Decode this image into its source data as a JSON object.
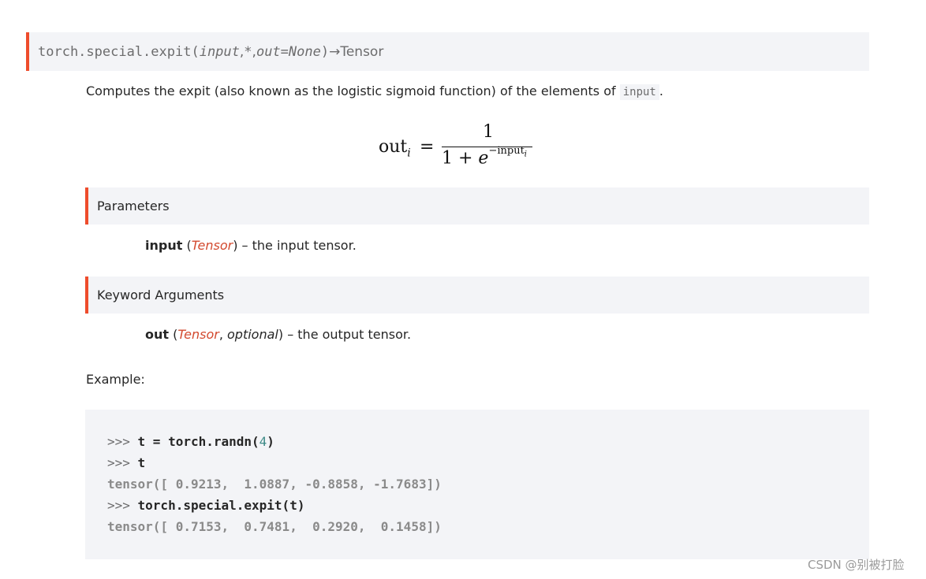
{
  "signature": {
    "func": "torch.special.expit(",
    "arg_input": "input",
    "sep1": ", ",
    "star": "*",
    "sep2": ", ",
    "arg_out": "out=None",
    "close": ")",
    "arrow": " → ",
    "returns": "Tensor"
  },
  "description": {
    "text_before": "Computes the expit (also known as the logistic sigmoid function) of the elements of ",
    "code": "input",
    "text_after": "."
  },
  "formula": {
    "lhs": "out",
    "lhs_sub": "i",
    "eq": "=",
    "numerator": "1",
    "denominator": "1 + ",
    "e": "e",
    "exp": "−input",
    "exp_sub": "i"
  },
  "parameters": {
    "heading": "Parameters",
    "name": "input",
    "open": " (",
    "type": "Tensor",
    "close": ")",
    "desc": " – the input tensor."
  },
  "keyword_arguments": {
    "heading": "Keyword Arguments",
    "name": "out",
    "open": " (",
    "type": "Tensor",
    "comma": ", ",
    "optional": "optional",
    "close": ")",
    "desc": " – the output tensor."
  },
  "example": {
    "label": "Example:",
    "lines": [
      {
        "prompt": ">>> ",
        "cmd": "t = torch.randn(",
        "num": "4",
        "cmd2": ")"
      },
      {
        "prompt": ">>> ",
        "cmd": "t"
      },
      {
        "output": "tensor([ 0.9213,  1.0887, -0.8858, -1.7683])"
      },
      {
        "prompt": ">>> ",
        "cmd": "torch.special.expit(t)"
      },
      {
        "output": "tensor([ 0.7153,  0.7481,  0.2920,  0.1458])"
      }
    ]
  },
  "watermark": "CSDN @别被打脸"
}
